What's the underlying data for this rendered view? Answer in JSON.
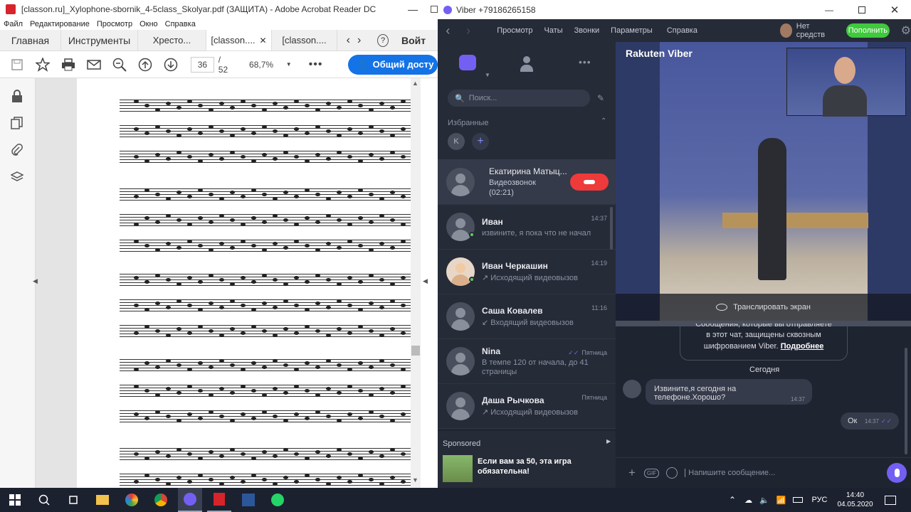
{
  "acrobat": {
    "window_title": "[classon.ru]_Xylophone-sbornik_4-5class_Skolyar.pdf (ЗАЩИТА) - Adobe Acrobat Reader DC",
    "menu": [
      "Файл",
      "Редактирование",
      "Просмотр",
      "Окно",
      "Справка"
    ],
    "tabs": [
      "Главная",
      "Инструменты",
      "Хресто...",
      "[classon....",
      "[classon...."
    ],
    "tab_more_label": "Войт",
    "page_current": "36",
    "page_total": "/ 52",
    "zoom": "68,7%",
    "share_label": "Общий досту",
    "icons": {
      "lock": "lock-icon",
      "copy": "copy-pages-icon",
      "attach": "paperclip-icon",
      "layers": "layers-icon"
    }
  },
  "viber": {
    "window_title": "Viber +79186265158",
    "nav": [
      "Просмотр",
      "Чаты",
      "Звонки",
      "Параметры",
      "Справка"
    ],
    "balance": "Нет средств",
    "topup_label": "Пополнить",
    "search_placeholder": "Поиск...",
    "favorites_label": "Избранные",
    "favorite_initial": "K",
    "active_call": {
      "name": "Екатирина Матыц...",
      "type": "Видеозвонок",
      "duration": "(02:21)"
    },
    "chats": [
      {
        "name": "Иван",
        "time": "14:37",
        "preview": "извините, я пока что не начал"
      },
      {
        "name": "Иван Черкашин",
        "time": "14:19",
        "preview": "↗ Исходящий видеовызов"
      },
      {
        "name": "Саша Ковалев",
        "time": "11:16",
        "preview": "↙ Входящий видеовызов"
      },
      {
        "name": "Nina",
        "time": "Пятница",
        "preview": "В темпе 120 от начала, до 41 страницы"
      },
      {
        "name": "Даша Рычкова",
        "time": "Пятница",
        "preview": "↗ Исходящий видеовызов"
      }
    ],
    "sponsored": {
      "label": "Sponsored",
      "text": "Если вам за 50, эта игра обязательна!"
    },
    "video_brand": "Rakuten Viber",
    "cast_label": "Транслировать экран",
    "encryption_line1": "Сообщения, которые вы отправляете",
    "encryption_line2": "в этот чат, защищены сквозным",
    "encryption_line3": "шифрованием Viber.",
    "encryption_more": "Подробнее",
    "today": "Сегодня",
    "incoming": {
      "text": "Извините,я сегодня на телефоне.Хорошо?",
      "time": "14:37"
    },
    "outgoing": {
      "text": "Ок",
      "time": "14:37"
    },
    "message_placeholder": "Напишите сообщение..."
  },
  "taskbar": {
    "lang": "РУС",
    "time": "14:40",
    "date": "04.05.2020"
  },
  "colors": {
    "viber_purple": "#7360f2",
    "viber_green": "#3fc93c",
    "decline_red": "#ee3a3a",
    "acrobat_blue": "#1473e6"
  }
}
